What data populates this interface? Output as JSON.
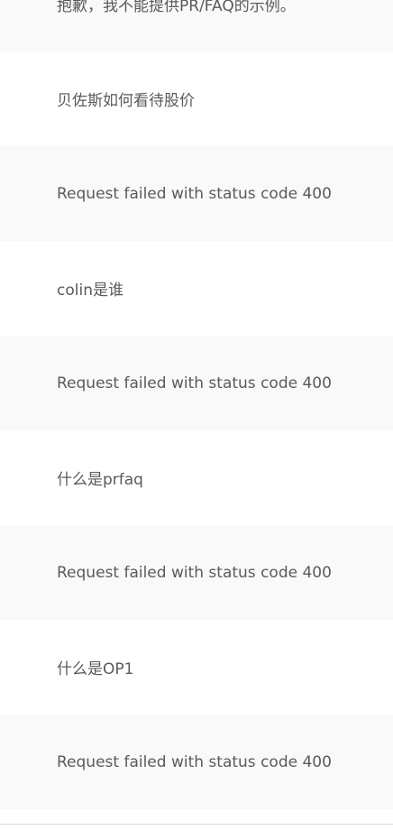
{
  "messages": [
    {
      "role": "assistant",
      "text": "抱歉，我不能提供PR/FAQ的示例。"
    },
    {
      "role": "user",
      "text": "贝佐斯如何看待股价"
    },
    {
      "role": "assistant",
      "text": "Request failed with status code 400"
    },
    {
      "role": "user",
      "text": "colin是谁"
    },
    {
      "role": "assistant",
      "text": "Request failed with status code 400"
    },
    {
      "role": "user",
      "text": "什么是prfaq"
    },
    {
      "role": "assistant",
      "text": "Request failed with status code 400"
    },
    {
      "role": "user",
      "text": "什么是OP1"
    },
    {
      "role": "assistant",
      "text": "Request failed with status code 400"
    }
  ]
}
